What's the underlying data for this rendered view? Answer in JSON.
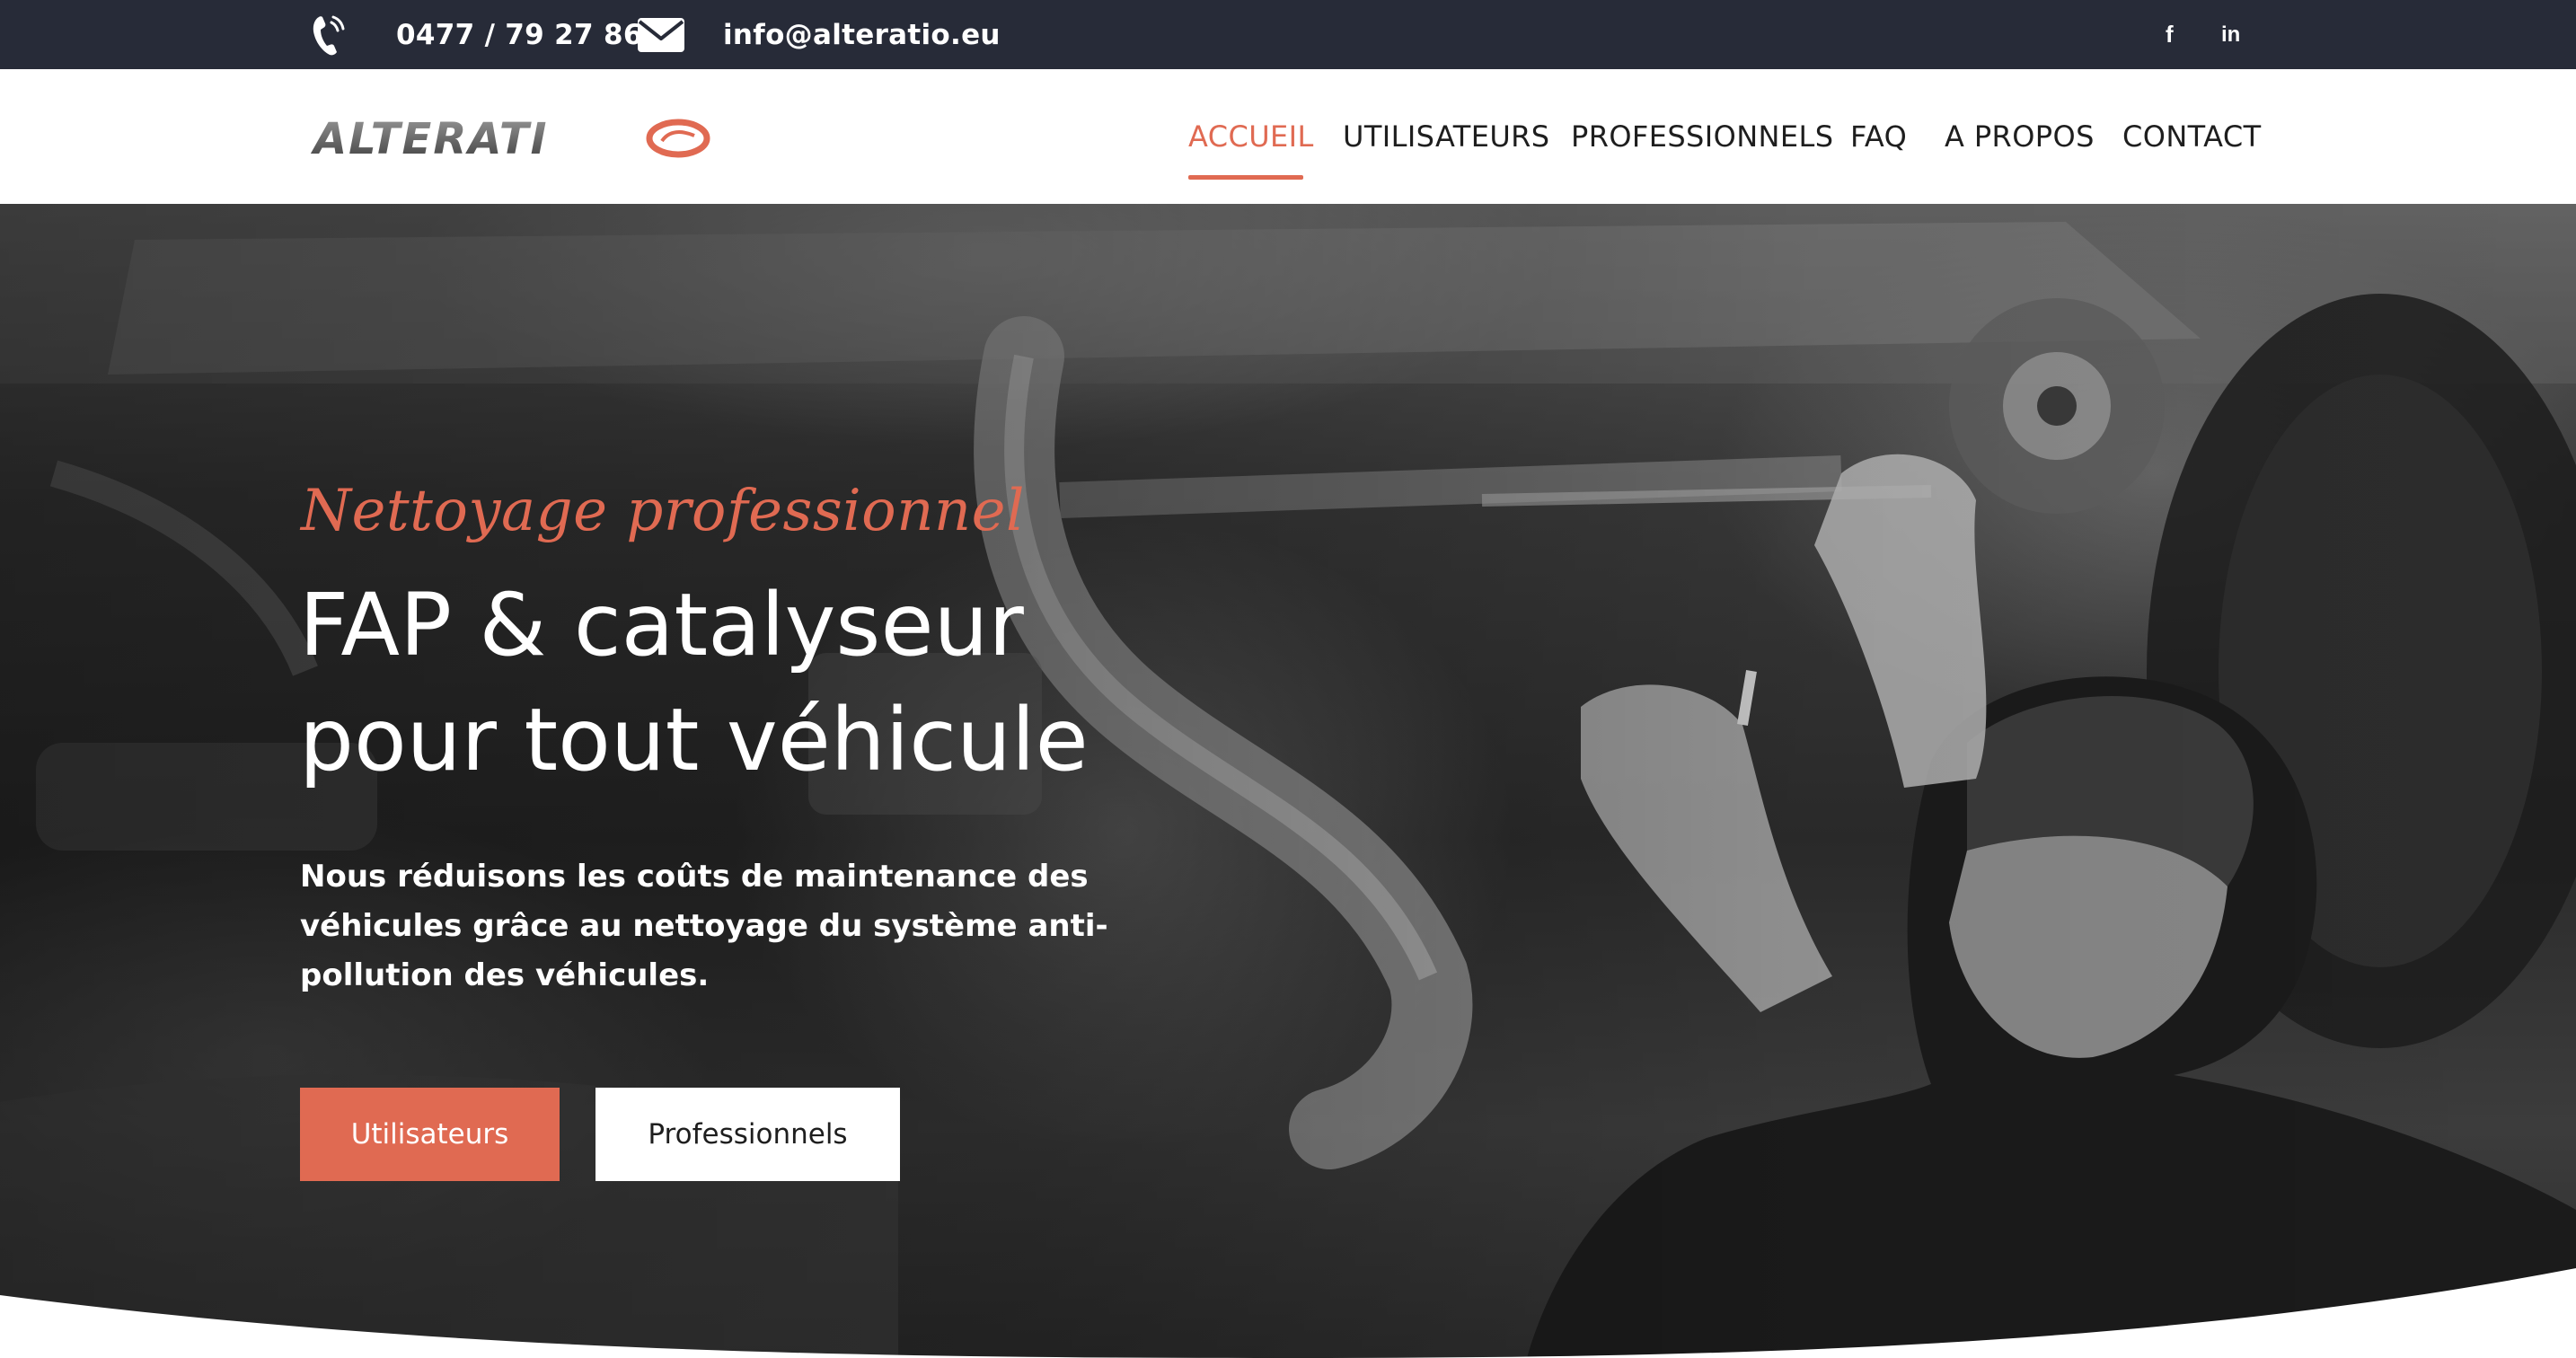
{
  "topbar": {
    "phone_icon": "phone-ringing-icon",
    "phone": "0477 / 79 27 86",
    "mail_icon": "envelope-icon",
    "email": "info@alteratio.eu",
    "social": [
      {
        "name": "facebook-icon",
        "glyph": "f"
      },
      {
        "name": "linkedin-icon",
        "glyph": "in"
      }
    ]
  },
  "header": {
    "logo_text": "ALTERATIO",
    "nav": [
      {
        "label": "ACCUEIL",
        "active": true
      },
      {
        "label": "UTILISATEURS",
        "active": false
      },
      {
        "label": "PROFESSIONNELS",
        "active": false
      },
      {
        "label": "FAQ",
        "active": false
      },
      {
        "label": "A PROPOS",
        "active": false
      },
      {
        "label": "CONTACT",
        "active": false
      }
    ]
  },
  "hero": {
    "script_title": "Nettoyage professionnel",
    "title_line1": "FAP & catalyseur",
    "title_line2": "pour tout véhicule",
    "description": "Nous réduisons les coûts de maintenance des véhicules grâce au nettoyage du système anti-pollution des véhicules.",
    "buttons": {
      "primary": "Utilisateurs",
      "secondary": "Professionnels"
    }
  },
  "colors": {
    "accent": "#e06a52",
    "topbar_bg": "#272b38",
    "text_dark": "#1e1e1e",
    "white": "#ffffff"
  }
}
